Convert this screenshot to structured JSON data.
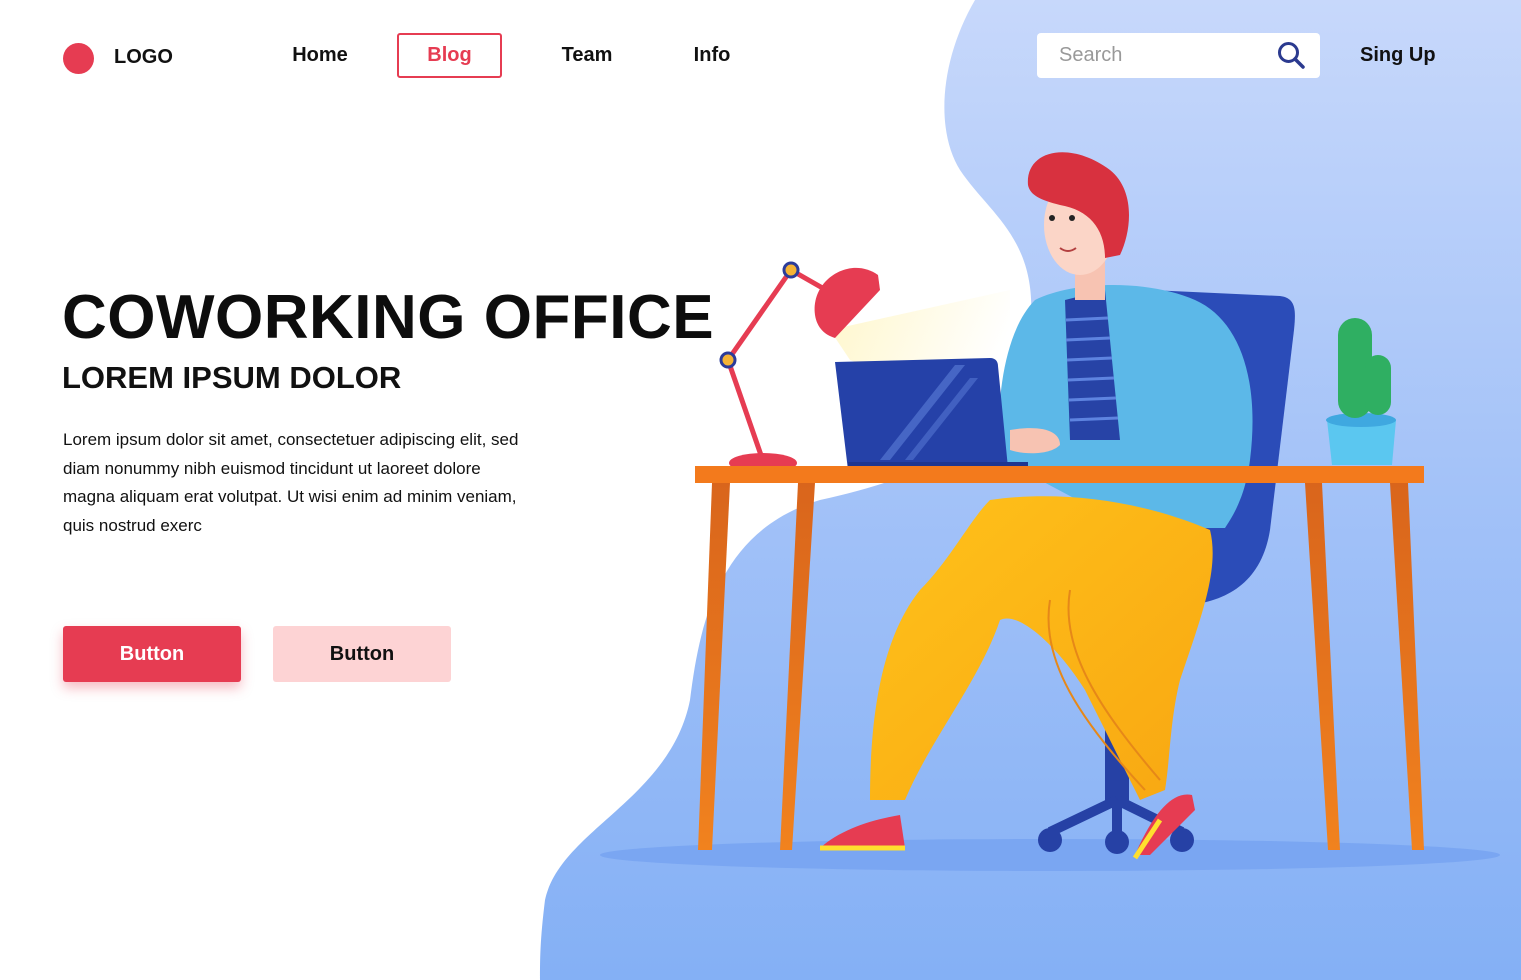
{
  "header": {
    "logo_label": "LOGO",
    "nav": [
      {
        "label": "Home",
        "active": false
      },
      {
        "label": "Blog",
        "active": true
      },
      {
        "label": "Team",
        "active": false
      },
      {
        "label": "Info",
        "active": false
      }
    ],
    "search": {
      "placeholder": "Search",
      "value": "",
      "icon": "search-icon"
    },
    "signup_label": "Sing Up"
  },
  "hero": {
    "title": "COWORKING OFFICE",
    "subtitle": "LOREM IPSUM DOLOR",
    "body": "Lorem ipsum dolor sit amet, consectetuer adipiscing elit, sed diam nonummy nibh euismod tincidunt ut laoreet dolore magna aliquam erat volutpat. Ut wisi enim ad minim veniam, quis nostrud exerc",
    "buttons": [
      {
        "label": "Button",
        "style": "primary"
      },
      {
        "label": "Button",
        "style": "secondary"
      }
    ]
  },
  "illustration": {
    "description": "Man sitting on office chair working on laptop at desk with desk lamp and cactus",
    "elements": [
      "background-blob",
      "desk-lamp",
      "laptop",
      "desk",
      "office-chair",
      "person",
      "cactus-plant",
      "floor-shadow"
    ]
  },
  "colors": {
    "accent": "#e63c52",
    "accent_light": "#fdd3d4",
    "blob_top": "#c4d6fb",
    "blob_bottom": "#86b2f6",
    "text": "#111111"
  }
}
